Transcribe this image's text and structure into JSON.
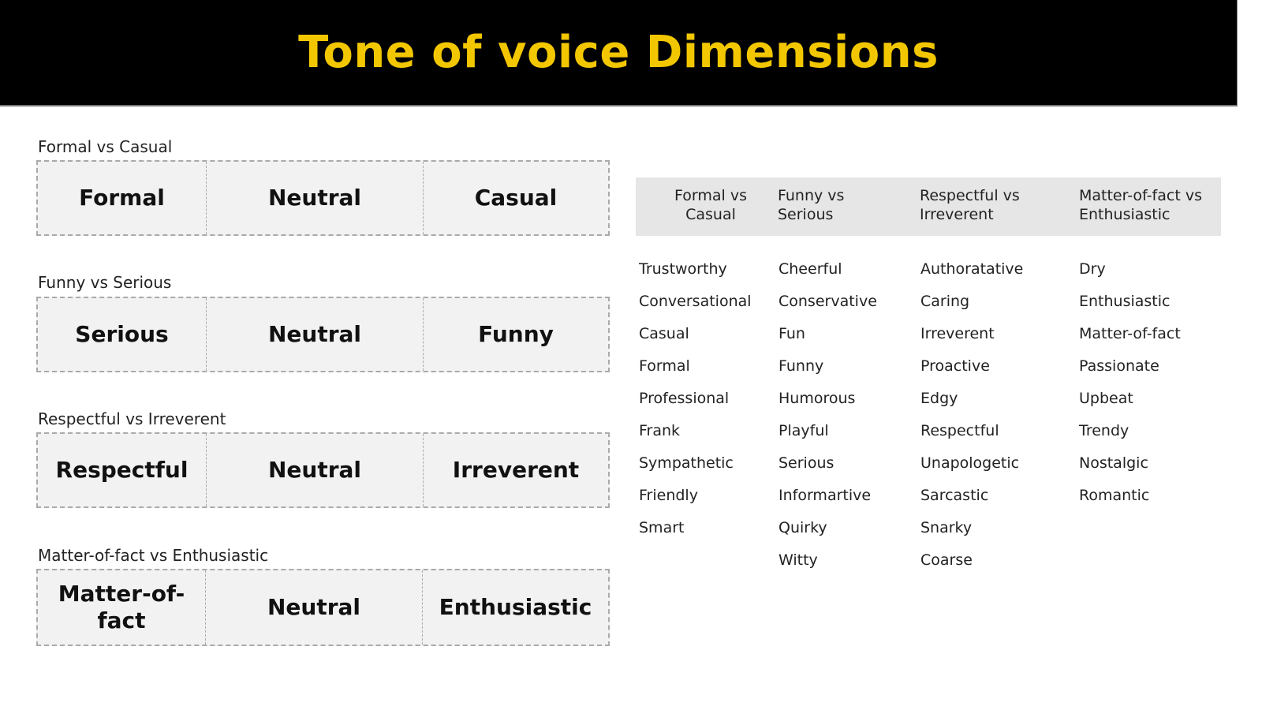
{
  "header": {
    "title": "Tone of voice Dimensions",
    "title_color": "#f2c700",
    "background": "#000000"
  },
  "scales": [
    {
      "label": "Formal vs Casual",
      "left": "Formal",
      "middle": "Neutral",
      "right": "Casual"
    },
    {
      "label": "Funny vs Serious",
      "left": "Serious",
      "middle": "Neutral",
      "right": "Funny"
    },
    {
      "label": "Respectful vs Irreverent",
      "left": "Respectful",
      "middle": "Neutral",
      "right": "Irreverent"
    },
    {
      "label": "Matter-of-fact vs Enthusiastic",
      "left": "Matter-of-fact",
      "middle": "Neutral",
      "right": "Enthusiastic"
    }
  ],
  "table": {
    "headers": [
      "Formal vs Casual",
      "Funny vs Serious",
      "Respectful vs Irreverent",
      "Matter-of-fact vs Enthusiastic"
    ],
    "columns": [
      [
        "Trustworthy",
        "Conversational",
        "Casual",
        "Formal",
        "Professional",
        "Frank",
        "Sympathetic",
        "Friendly",
        "Smart"
      ],
      [
        "Cheerful",
        "Conservative",
        "Fun",
        "Funny",
        "Humorous",
        "Playful",
        "Serious",
        "Informartive",
        "Quirky",
        "Witty"
      ],
      [
        "Authoratative",
        "Caring",
        "Irreverent",
        "Proactive",
        "Edgy",
        "Respectful",
        "Unapologetic",
        "Sarcastic",
        "Snarky",
        "Coarse"
      ],
      [
        "Dry",
        "Enthusiastic",
        "Matter-of-fact",
        "Passionate",
        "Upbeat",
        "Trendy",
        "Nostalgic",
        "Romantic"
      ]
    ]
  }
}
